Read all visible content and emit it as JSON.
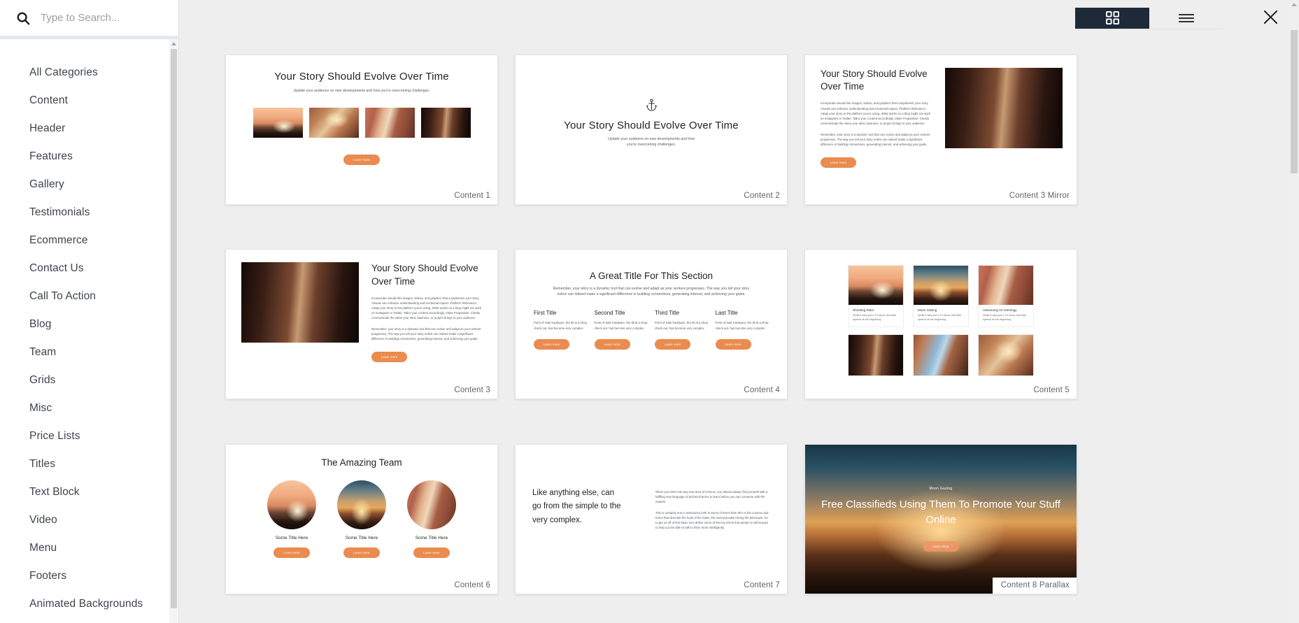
{
  "sidebar": {
    "search": {
      "placeholder": "Type to Search...",
      "value": "",
      "icon": "search-icon"
    },
    "categories": [
      {
        "label": "All Categories"
      },
      {
        "label": "Content"
      },
      {
        "label": "Header"
      },
      {
        "label": "Features"
      },
      {
        "label": "Gallery"
      },
      {
        "label": "Testimonials"
      },
      {
        "label": "Ecommerce"
      },
      {
        "label": "Contact Us"
      },
      {
        "label": "Call To Action"
      },
      {
        "label": "Blog"
      },
      {
        "label": "Team"
      },
      {
        "label": "Grids"
      },
      {
        "label": "Misc"
      },
      {
        "label": "Price Lists"
      },
      {
        "label": "Titles"
      },
      {
        "label": "Text Block"
      },
      {
        "label": "Video"
      },
      {
        "label": "Menu"
      },
      {
        "label": "Footers"
      },
      {
        "label": "Animated Backgrounds"
      }
    ]
  },
  "toolbar": {
    "grid_view": {
      "name": "grid-view-toggle",
      "active": true
    },
    "list_view": {
      "name": "list-view-toggle",
      "active": false
    },
    "close": {
      "name": "close-button"
    }
  },
  "common": {
    "learn_more": "Learn more",
    "accent_color": "#ea8b4f",
    "active_toggle_color": "#1e2a38"
  },
  "cards": [
    {
      "id": "content-1",
      "label": "Content 1",
      "title": "Your Story Should Evolve Over Time",
      "subtitle": "Update your audience on new developments and how you're overcoming challenges.",
      "button": "Learn more"
    },
    {
      "id": "content-2",
      "label": "Content 2",
      "icon": "anchor-icon",
      "title": "Your Story Should Evolve Over Time",
      "subtitle_line1": "Update your audience on new developments and how",
      "subtitle_line2": "you're overcoming challenges."
    },
    {
      "id": "content-3-mirror",
      "label": "Content 3 Mirror",
      "title": "Your Story Should Evolve Over Time",
      "paragraph1": "Incorporate visuals like images, videos, and graphics that complement your story. Visuals can enhance understanding and emotional impact. Platform Relevance: Adapt your story to the platform you're using. What works on a blog might not work on Instagram or Twitter. Tailor your content accordingly. Value Proposition: Clearly communicate the value your idea, business, or project brings to your audience.",
      "paragraph2": "Remember, your story is a dynamic tool that can evolve and adapt as your venture progresses. The way you tell your story online can indeed make a significant difference in building connections, generating interest, and achieving your goals.",
      "button": "Learn more"
    },
    {
      "id": "content-3",
      "label": "Content 3",
      "title": "Your Story Should Evolve Over Time",
      "paragraph1": "Incorporate visuals like images, videos, and graphics that complement your story. Visuals can enhance understanding and emotional impact. Platform Relevance: Adapt your story to the platform you're using. What works on a blog might not work on Instagram or Twitter. Tailor your content accordingly. Value Proposition: Clearly communicate the value your idea, business, or project brings to your audience.",
      "paragraph2": "Remember, your story is a dynamic tool that can evolve and adapt as your venture progresses. The way you tell your story online can indeed make a significant difference in building connections, generating interest, and achieving your goals.",
      "button": "Learn more"
    },
    {
      "id": "content-4",
      "label": "Content 4",
      "title": "A Great Title For This Section",
      "subtitle": "Remember, your story is a dynamic tool that can evolve and adapt as your venture progresses. The way you tell your story online can indeed make a significant difference in building connections, generating interest, and achieving your goals.",
      "columns": [
        {
          "title": "First Title",
          "body": "Point of Sale hardware, the till at a shop check out, has become very complex",
          "button": "Learn more"
        },
        {
          "title": "Second Title",
          "body": "Point of Sale hardware, the till at a shop check out, has become very complex",
          "button": "Learn more"
        },
        {
          "title": "Third Title",
          "body": "Point of Sale hardware, the till at a shop check out, has become very complex",
          "button": "Learn more"
        },
        {
          "title": "Last Title",
          "body": "Point of Sale hardware, the till at a shop check out, has become very complex",
          "button": "Learn more"
        }
      ]
    },
    {
      "id": "content-5",
      "label": "Content 5",
      "tiles": [
        {
          "title": "Shooting Stars",
          "body": "While it was just a TV show, that little speech at the beginning"
        },
        {
          "title": "Moon Gazing",
          "body": "While it was just a TV show, that little speech at the beginning"
        },
        {
          "title": "Astronomy Or Astrology",
          "body": "While it was just a TV show, that little speech at the beginning"
        }
      ]
    },
    {
      "id": "content-6",
      "label": "Content 6",
      "title": "The Amazing Team",
      "members": [
        {
          "name": "Some Title Here",
          "button": "Learn more"
        },
        {
          "name": "Some Title Here",
          "button": "Learn more"
        },
        {
          "name": "Some Title Here",
          "button": "Learn more"
        }
      ]
    },
    {
      "id": "content-7",
      "label": "Content 7",
      "heading_line1": "Like anything else, can",
      "heading_line2": "go from the simple to the",
      "heading_line3": "very complex.",
      "paragraph1": "When you enter into any new area of science, you almost always find yourself with a baffling new language of technical terms to learn before you can converse with the experts.",
      "paragraph2": "This is certainly true in astronomy both in terms of terms that refer to the cosmos and terms that describe the tools of the trade, the most prevalent being the telescope. So to get us off of first base, let's define some of the key terms that pertain to telescopes to help you be able to talk to them more intelligently."
    },
    {
      "id": "content-8-parallax",
      "label": "Content 8 Parallax",
      "eyebrow": "Moon Gazing",
      "title_line1": "Free Classifieds Using Them To Promote Your Stuff",
      "title_line2": "Online",
      "button": "Learn more"
    }
  ]
}
